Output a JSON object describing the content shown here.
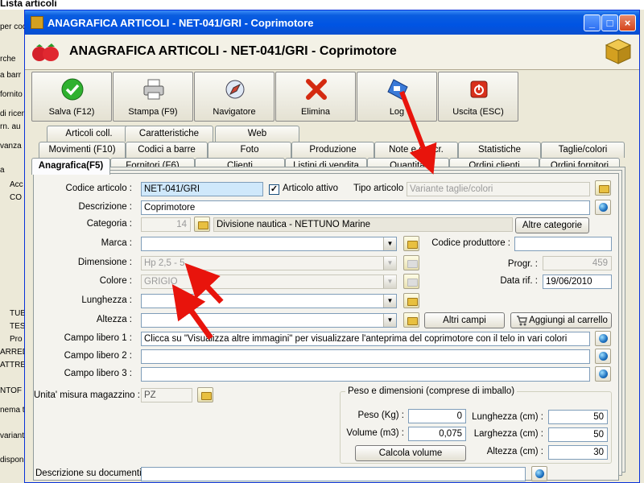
{
  "background": {
    "title": "Lista articoli",
    "left_texts": [
      "per cod",
      "rche",
      "a barr",
      "fornito",
      "di ricer",
      "rn. au",
      "vanza",
      "a",
      "Acc",
      "CO",
      "TUB",
      "TES",
      "Pro",
      "ARREDA",
      "ATTREZ",
      "NTOF",
      "nema tu",
      "variante",
      "dispon"
    ]
  },
  "window": {
    "title": "ANAGRAFICA ARTICOLI - NET-041/GRI - Coprimotore",
    "header_title": "ANAGRAFICA ARTICOLI - NET-041/GRI - Coprimotore",
    "controls": {
      "minimize": "_",
      "maximize": "□",
      "close": "×"
    }
  },
  "toolbar": [
    {
      "id": "save",
      "label": "Salva (F12)",
      "icon": "checkmark-icon"
    },
    {
      "id": "print",
      "label": "Stampa (F9)",
      "icon": "printer-icon"
    },
    {
      "id": "nav",
      "label": "Navigatore",
      "icon": "compass-icon"
    },
    {
      "id": "delete",
      "label": "Elimina",
      "icon": "red-x-icon"
    },
    {
      "id": "log",
      "label": "Log",
      "icon": "log-icon"
    },
    {
      "id": "exit",
      "label": "Uscita (ESC)",
      "icon": "power-icon"
    }
  ],
  "tabs": {
    "row1": [
      "Articoli coll.",
      "Caratteristiche",
      "Web"
    ],
    "row2": [
      "Movimenti (F10)",
      "Codici a barre",
      "Foto",
      "Produzione",
      "Note e descr.",
      "Statistiche",
      "Taglie/colori"
    ],
    "row3": [
      "Anagrafica(F5)",
      "Fornitori (F6)",
      "Clienti",
      "Listini di vendita",
      "Quantita'",
      "Ordini clienti",
      "Ordini fornitori"
    ],
    "active": "Anagrafica(F5)"
  },
  "form": {
    "codice_articolo_label": "Codice articolo :",
    "codice_articolo": "NET-041/GRI",
    "articolo_attivo_label": "Articolo attivo",
    "articolo_attivo_check": "✓",
    "tipo_articolo_label": "Tipo articolo :",
    "tipo_articolo": "Variante taglie/colori",
    "descrizione_label": "Descrizione :",
    "descrizione": "Coprimotore",
    "categoria_label": "Categoria :",
    "categoria_num": "14",
    "categoria_nome": "Divisione nautica - NETTUNO Marine",
    "altre_categorie": "Altre categorie",
    "marca_label": "Marca :",
    "codice_produttore_label": "Codice produttore :",
    "dimensione_label": "Dimensione :",
    "dimensione": "Hp 2,5 - 5",
    "progr_label": "Progr. :",
    "progr": "459",
    "colore_label": "Colore :",
    "colore": "GRIGIO",
    "data_rif_label": "Data rif. :",
    "data_rif": "19/06/2010",
    "lunghezza_label": "Lunghezza :",
    "altezza_label": "Altezza :",
    "altri_campi": "Altri campi",
    "aggiungi_carrello": "Aggiungi al carrello",
    "campo1_label": "Campo libero 1 :",
    "campo1": "Clicca su \"Visualizza altre immagini\" per visualizzare l'anteprima del coprimotore con il telo in vari colori",
    "campo2_label": "Campo libero 2 :",
    "campo3_label": "Campo libero 3 :",
    "unita_label": "Unita' misura magazzino :",
    "unita": "PZ",
    "peso_group": "Peso e dimensioni (comprese di imballo)",
    "peso_label": "Peso (Kg) :",
    "peso": "0",
    "volume_label": "Volume (m3) :",
    "volume": "0,075",
    "calcola_volume": "Calcola volume",
    "lunghezza_cm_label": "Lunghezza (cm) :",
    "lunghezza_cm": "50",
    "larghezza_cm_label": "Larghezza (cm) :",
    "larghezza_cm": "50",
    "altezza_cm_label": "Altezza (cm) :",
    "altezza_cm": "30",
    "desc_documenti_label": "Descrizione su documenti:"
  },
  "colors": {
    "arrow": "#e8140c",
    "titlebar": "#0054e3",
    "highlight_input": "#cfe8fb"
  }
}
